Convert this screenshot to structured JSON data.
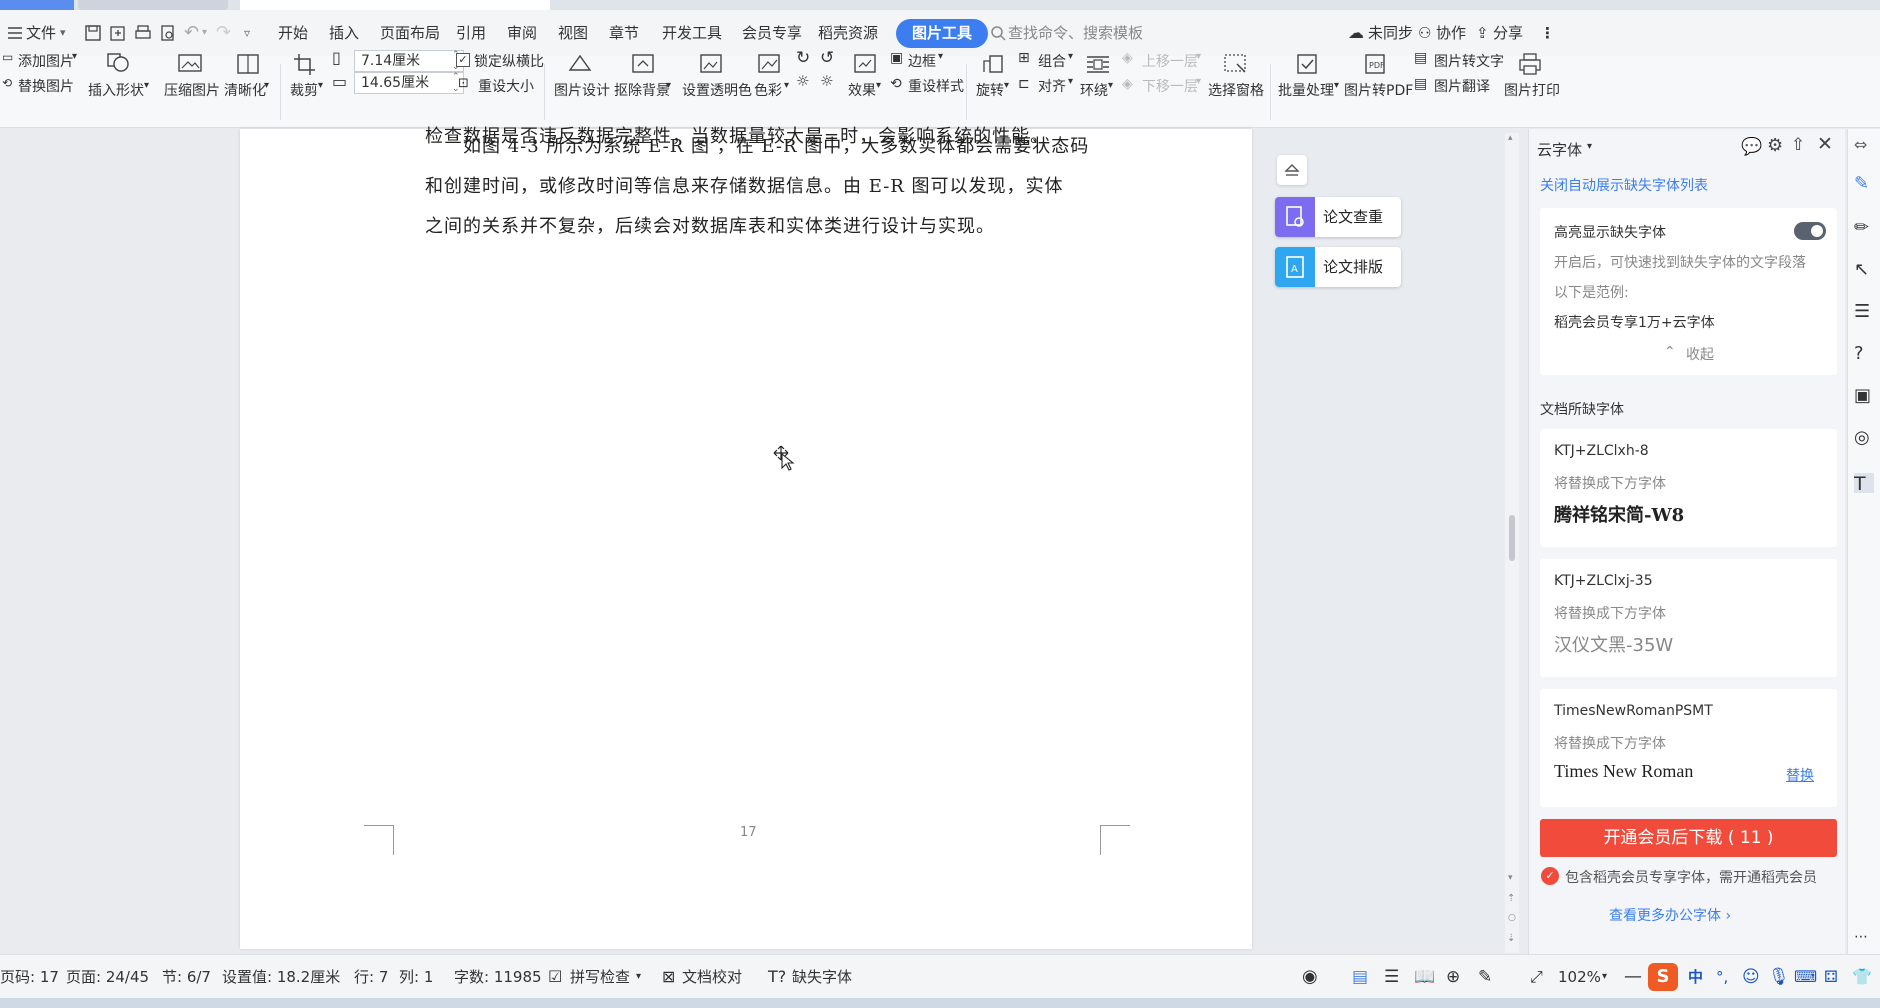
{
  "menu": {
    "file": "文件",
    "tabs": [
      "开始",
      "插入",
      "页面布局",
      "引用",
      "审阅",
      "视图",
      "章节",
      "开发工具",
      "会员专享",
      "稻壳资源"
    ],
    "active_tab": "图片工具",
    "search_placeholder": "查找命令、搜索模板",
    "sync": "未同步",
    "collab": "协作",
    "share": "分享"
  },
  "ribbon": {
    "add_image": "添加图片",
    "replace_image": "替换图片",
    "insert_shape": "插入形状",
    "compress": "压缩图片",
    "sharpen": "清晰化",
    "crop": "裁剪",
    "width": "7.14厘米",
    "height": "14.65厘米",
    "lock_ratio": "锁定纵横比",
    "reset_size": "重设大小",
    "image_design": "图片设计",
    "remove_bg": "抠除背景",
    "set_transparent": "设置透明色",
    "color": "色彩",
    "effects": "效果",
    "border": "边框",
    "reset_style": "重设样式",
    "rotate": "旋转",
    "group": "组合",
    "align": "对齐",
    "wrap": "环绕",
    "bring_forward": "上移一层",
    "send_backward": "下移一层",
    "selection_pane": "选择窗格",
    "batch": "批量处理",
    "to_pdf": "图片转PDF",
    "to_text": "图片转文字",
    "translate": "图片翻译",
    "print": "图片打印"
  },
  "document": {
    "line_cut": "检查数据是否违反数据完整性，当数据量较大是=时，会影响系统的性能。",
    "para_lines": [
      "　　如图 4-3 所示为系统 E-R 图 ，在 E-R 图中，大多数实体都会需要状态码",
      "和创建时间，或修改时间等信息来存储数据信息。由 E-R 图可以发现，实体",
      "之间的关系并不复杂，后续会对数据库表和实体类进行设计与实现。"
    ],
    "page_number": "17"
  },
  "float_tools": {
    "check": "论文查重",
    "format": "论文排版"
  },
  "panel": {
    "title": "云字体",
    "close_auto": "关闭自动展示缺失字体列表",
    "highlight_title": "高亮显示缺失字体",
    "highlight_desc": "开启后，可快速找到缺失字体的文字段落",
    "example_label": "以下是范例:",
    "example_text": "稻壳会员专享1万+云字体",
    "collapse": "收起",
    "missing_title": "文档所缺字体",
    "replace_hint": "将替换成下方字体",
    "fonts": [
      {
        "name": "KTJ+ZLClxh-8",
        "replacement": "腾祥铭宋简-W8"
      },
      {
        "name": "KTJ+ZLClxj-35",
        "replacement": "汉仪文黑-35W"
      },
      {
        "name": "TimesNewRomanPSMT",
        "replacement": "Times New Roman",
        "action": "替换"
      }
    ],
    "vip_button": "开通会员后下载 ( 11 )",
    "vip_note": "包含稻壳会员专享字体，需开通稻壳会员",
    "more_fonts": "查看更多办公字体 ›"
  },
  "status": {
    "page_code": "页码: 17",
    "pages": "页面: 24/45",
    "section": "节: 6/7",
    "setting": "设置值: 18.2厘米",
    "row": "行: 7",
    "col": "列: 1",
    "words": "字数: 11985",
    "spell": "拼写检查",
    "proof": "文档校对",
    "missing_font": "缺失字体",
    "zoom": "102%",
    "ime": "中"
  },
  "colors": {
    "accent": "#3c7ef0",
    "vip_red": "#f04b3b"
  }
}
